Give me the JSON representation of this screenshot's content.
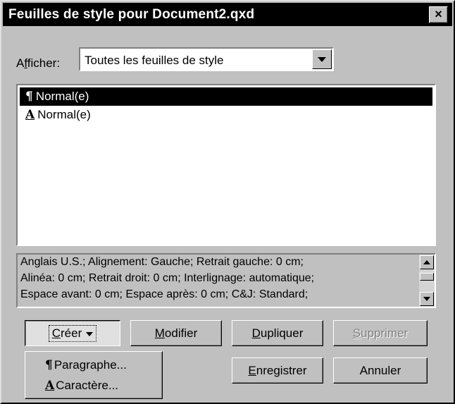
{
  "window": {
    "title": "Feuilles de style pour Document2.qxd",
    "close_glyph": "×"
  },
  "afficher": {
    "label_pre": "A",
    "label_mn": "f",
    "label_post": "ficher:",
    "value": "Toutes les feuilles de style"
  },
  "styles": [
    {
      "icon": "¶",
      "icon_name": "paragraph-icon",
      "label": "Normal(e)",
      "selected": true
    },
    {
      "icon": "A",
      "icon_name": "character-icon",
      "label": "Normal(e)",
      "selected": false
    }
  ],
  "description": [
    "Anglais U.S.;  Alignement: Gauche;  Retrait gauche: 0 cm;",
    "Alinéa: 0 cm;  Retrait droit: 0 cm;  Interlignage: automatique;",
    "Espace avant: 0 cm;  Espace après: 0 cm;  C&J: Standard;"
  ],
  "buttons": {
    "creer": {
      "mn": "C",
      "rest": "réer"
    },
    "modifier": {
      "mn": "M",
      "rest": "odifier"
    },
    "dupliquer": {
      "mn": "D",
      "rest": "upliquer"
    },
    "supprimer": {
      "mn": "S",
      "rest": "upprimer"
    },
    "enregistrer": {
      "mn": "E",
      "rest": "nregistrer"
    },
    "annuler": {
      "label": "Annuler"
    }
  },
  "creer_menu": [
    {
      "icon": "¶",
      "icon_name": "paragraph-icon",
      "label": "Paragraphe..."
    },
    {
      "icon": "A",
      "icon_name": "character-icon",
      "label": "Caractère..."
    }
  ]
}
